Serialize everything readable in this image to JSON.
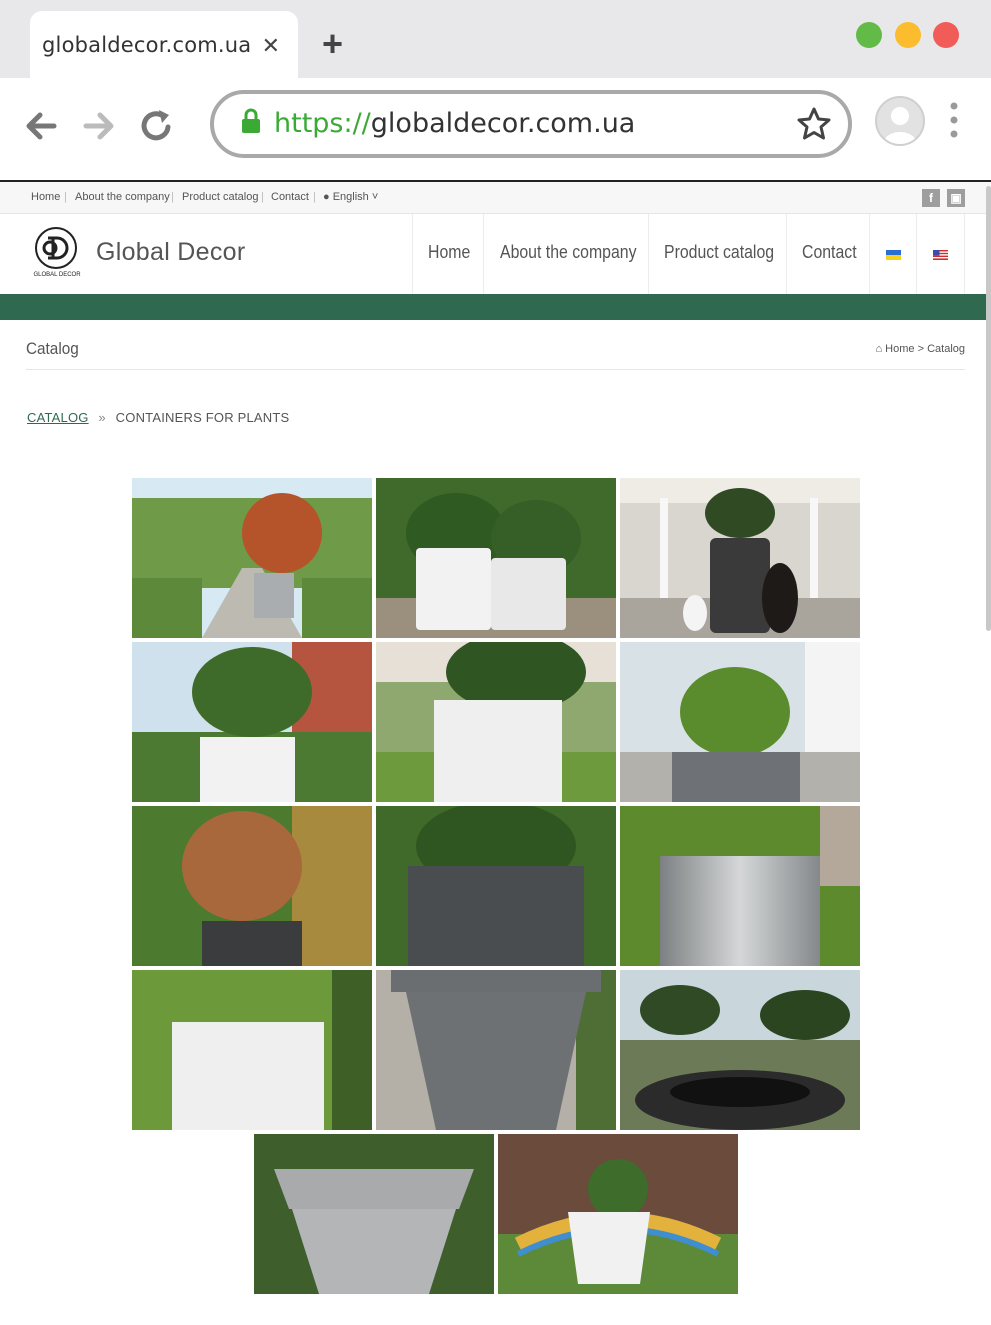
{
  "browser": {
    "tab_title": "globaldecor.com.ua",
    "url_protocol": "https://",
    "url_host": "globaldecor.com.ua",
    "window_dot_colors": [
      "#61bb46",
      "#fbbd2d",
      "#f15b58"
    ]
  },
  "topbar": {
    "links": [
      "Home",
      "About the company",
      "Product catalog",
      "Contact"
    ],
    "language": "English"
  },
  "header": {
    "brand": "Global Decor",
    "logo_caption": "GLOBAL DECOR",
    "menu": [
      "Home",
      "About the company",
      "Product catalog",
      "Contact"
    ]
  },
  "page": {
    "title": "Catalog",
    "breadcrumb_home": "Home",
    "breadcrumb_sep": ">",
    "breadcrumb_current": "Catalog",
    "catalog_link": "CATALOG",
    "catalog_sep": "»",
    "category": "CONTAINERS FOR PLANTS"
  },
  "colors": {
    "brand_green": "#2f6a50",
    "secure_green": "#3aaa35"
  }
}
